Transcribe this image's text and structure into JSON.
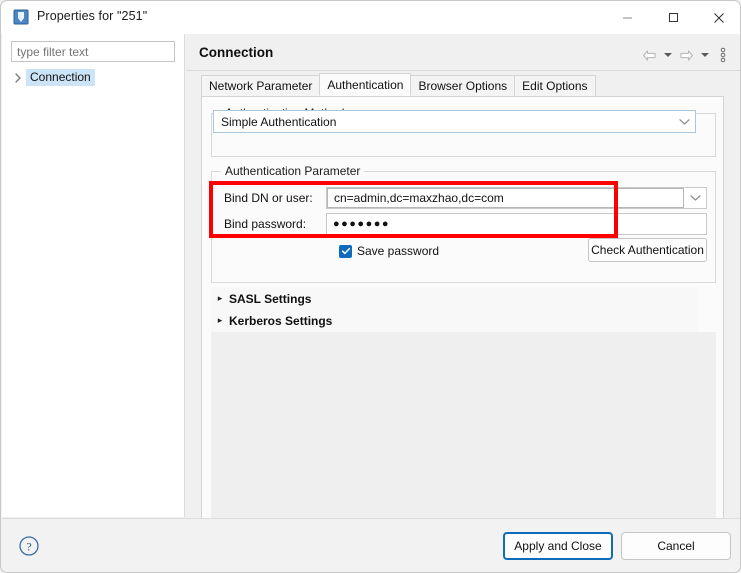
{
  "window": {
    "title": "Properties for \"251\"",
    "icon": "properties-app-icon",
    "minimize_label": "—",
    "maximize_label": "□",
    "close_label": "✕"
  },
  "sidebar": {
    "filter_placeholder": "type filter text",
    "filter_value": "",
    "items": [
      {
        "label": "Connection",
        "expand_arrow": "›",
        "selected": true
      }
    ]
  },
  "header": {
    "title": "Connection",
    "nav": {
      "back_icon": "back-arrow-icon",
      "back_caret": "chevron-down-icon",
      "forward_icon": "forward-arrow-icon",
      "forward_caret": "chevron-down-icon",
      "menu_icon": "view-menu-icon"
    }
  },
  "tabs": [
    {
      "label": "Network Parameter",
      "active": false
    },
    {
      "label": "Authentication",
      "active": true
    },
    {
      "label": "Browser Options",
      "active": false
    },
    {
      "label": "Edit Options",
      "active": false
    }
  ],
  "authentication_method": {
    "group_title": "Authentication Method",
    "combo_value": "Simple Authentication",
    "combo_chevron": "chevron-down-icon"
  },
  "authentication_parameter": {
    "group_title": "Authentication Parameter",
    "bind_dn_label": "Bind DN or user:",
    "bind_dn_value": "cn=admin,dc=maxzhao,dc=com",
    "bind_dn_chevron": "chevron-down-icon",
    "bind_password_label": "Bind password:",
    "bind_password_masked": "●●●●●●●",
    "save_password_label": "Save password",
    "save_password_checked": true,
    "check_authentication_label": "Check Authentication"
  },
  "expanders": [
    {
      "label": "SASL Settings",
      "arrow": "▸",
      "expanded": false
    },
    {
      "label": "Kerberos Settings",
      "arrow": "▸",
      "expanded": false
    }
  ],
  "footer": {
    "help_icon": "help-question-icon",
    "apply_label": "Apply and Close",
    "cancel_label": "Cancel"
  },
  "colors": {
    "accent": "#0f6cbd",
    "annotation": "#ff0000",
    "selection": "#cce4f7",
    "window_bg": "#f0f0f0",
    "panel_bg": "#fbfbfb"
  }
}
